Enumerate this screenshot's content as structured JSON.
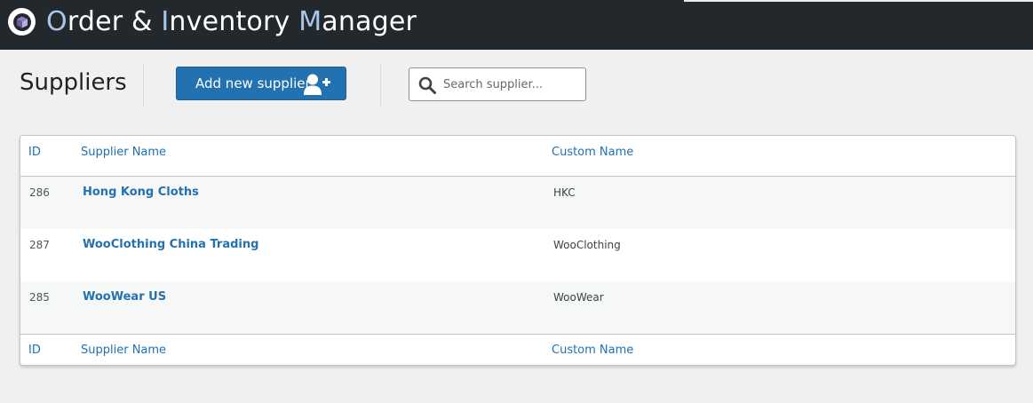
{
  "app": {
    "title_parts": [
      {
        "text": "O",
        "highlight": true
      },
      {
        "text": "rder & ",
        "highlight": false
      },
      {
        "text": "I",
        "highlight": true
      },
      {
        "text": "nventory ",
        "highlight": false
      },
      {
        "text": "M",
        "highlight": true
      },
      {
        "text": "anager",
        "highlight": false
      }
    ],
    "logo_icon": "box-icon"
  },
  "page": {
    "title": "Suppliers"
  },
  "toolbar": {
    "add_label": "Add new supplier",
    "add_icon": "add-user-icon",
    "search_placeholder": "Search supplier...",
    "search_value": "",
    "search_icon": "search-icon"
  },
  "table": {
    "columns": {
      "id": "ID",
      "supplier_name": "Supplier Name",
      "custom_name": "Custom Name"
    },
    "rows": [
      {
        "id": "286",
        "supplier_name": "Hong Kong Cloths",
        "custom_name": "HKC"
      },
      {
        "id": "287",
        "supplier_name": "WooClothing China Trading",
        "custom_name": "WooClothing"
      },
      {
        "id": "285",
        "supplier_name": "WooWear US",
        "custom_name": "WooWear"
      }
    ]
  },
  "colors": {
    "topbar": "#23282d",
    "accent": "#2271b1",
    "title_highlight": "#a8c8ea",
    "background": "#f0f0f1"
  }
}
